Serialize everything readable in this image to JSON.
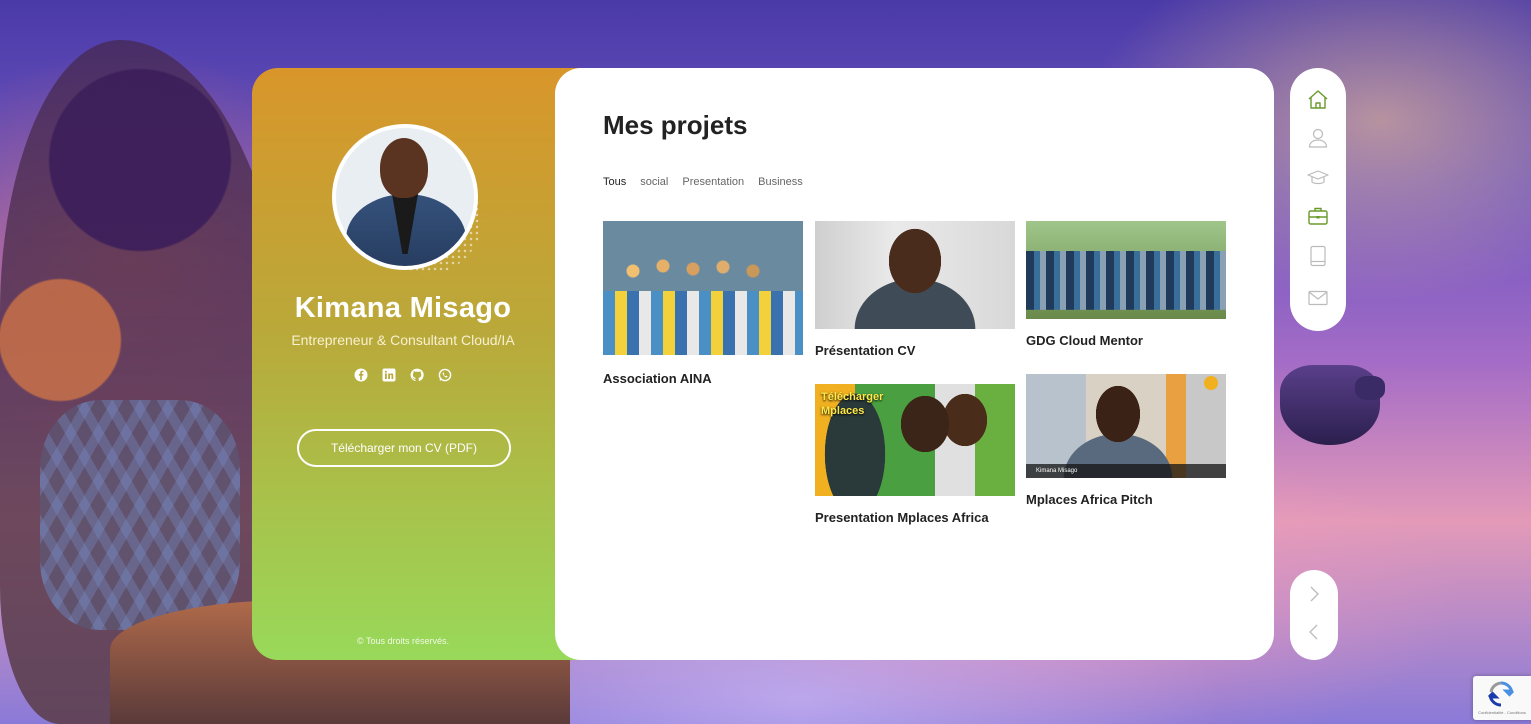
{
  "profile": {
    "name": "Kimana Misago",
    "role": "Entrepreneur & Consultant Cloud/IA",
    "cv_button": "Télécharger mon CV (PDF)",
    "copyright": "© Tous droits réservés.",
    "socials": [
      "facebook-icon",
      "linkedin-icon",
      "github-icon",
      "whatsapp-icon"
    ]
  },
  "main": {
    "title": "Mes projets",
    "filters": [
      "Tous",
      "social",
      "Presentation",
      "Business"
    ],
    "active_filter": "Tous",
    "projects": [
      {
        "title": "Association AINA"
      },
      {
        "title": "Présentation CV"
      },
      {
        "title": "GDG Cloud Mentor"
      },
      {
        "title": "Presentation Mplaces Africa",
        "thumb_text": "Télécharger Mplaces"
      },
      {
        "title": "Mplaces Africa Pitch",
        "thumb_caption": "Kimana Misago"
      }
    ]
  },
  "nav": {
    "items": [
      "home-icon",
      "user-icon",
      "graduation-cap-icon",
      "briefcase-icon",
      "tablet-icon",
      "mail-icon"
    ],
    "active": "home-icon",
    "accent": "#6a9a2a"
  },
  "recaptcha": {
    "text": "Confidentialité - Conditions"
  }
}
